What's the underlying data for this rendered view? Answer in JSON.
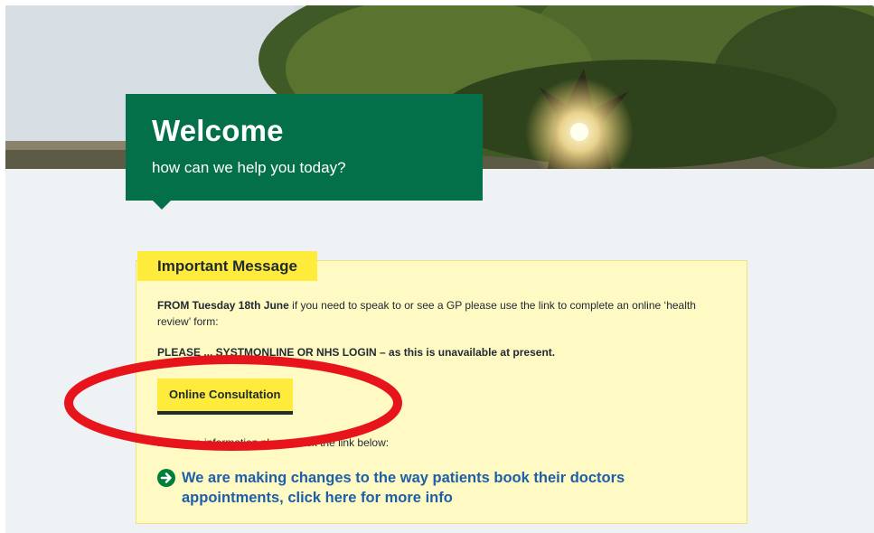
{
  "hero": {
    "title": "Welcome",
    "subtitle": "how can we help you today?"
  },
  "message": {
    "heading": "Important Message",
    "line1_bold": "FROM Tuesday 18th June",
    "line1_rest": " if you need to speak to or see a GP please use the link to complete an online ‘health review’ form:",
    "line2_visible": "PLEASE ... SYSTMONLINE OR NHS LOGIN",
    "line2_rest": " – as this is unavailable at present.",
    "button_label": "Online Consultation",
    "more_info_text": "For more information please click the link below:",
    "link_text": "We are making changes to the way patients book their doctors appointments, click here for more info"
  },
  "colors": {
    "brand_green": "#03704a",
    "yellow": "#ffeb3b",
    "panel_yellow": "#fff9c4",
    "link_blue": "#1d5fa8",
    "annotation_red": "#e8141b"
  },
  "icons": {
    "link_arrow": "arrow-right-circle-icon"
  }
}
